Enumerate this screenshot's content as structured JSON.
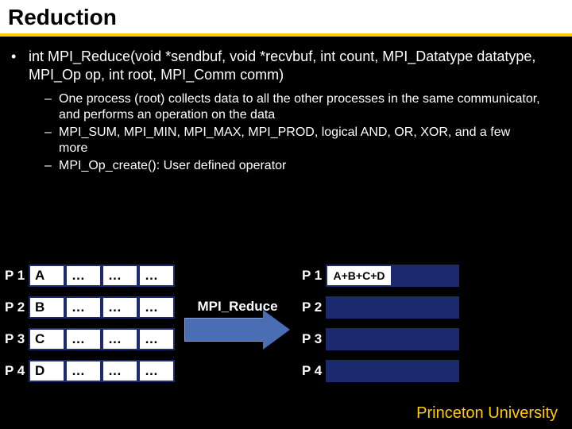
{
  "title": "Reduction",
  "main_bullet": "int MPI_Reduce(void *sendbuf, void *recvbuf, int count, MPI_Datatype datatype, MPI_Op op, int root, MPI_Comm comm)",
  "sub_bullets": [
    "One process (root) collects data to all the other processes in the same communicator, and performs an operation on the data",
    "MPI_SUM, MPI_MIN, MPI_MAX, MPI_PROD, logical AND, OR, XOR, and a few more",
    "MPI_Op_create(): User defined operator"
  ],
  "left_rows": [
    {
      "label": "P 1",
      "cells": [
        "A",
        "…",
        "…",
        "…"
      ]
    },
    {
      "label": "P 2",
      "cells": [
        "B",
        "…",
        "…",
        "…"
      ]
    },
    {
      "label": "P 3",
      "cells": [
        "C",
        "…",
        "…",
        "…"
      ]
    },
    {
      "label": "P 4",
      "cells": [
        "D",
        "…",
        "…",
        "…"
      ]
    }
  ],
  "arrow_label": "MPI_Reduce",
  "right_rows": [
    {
      "label": "P 1",
      "result": "A+B+C+D"
    },
    {
      "label": "P 2",
      "result": ""
    },
    {
      "label": "P 3",
      "result": ""
    },
    {
      "label": "P 4",
      "result": ""
    }
  ],
  "footer": "Princeton University"
}
